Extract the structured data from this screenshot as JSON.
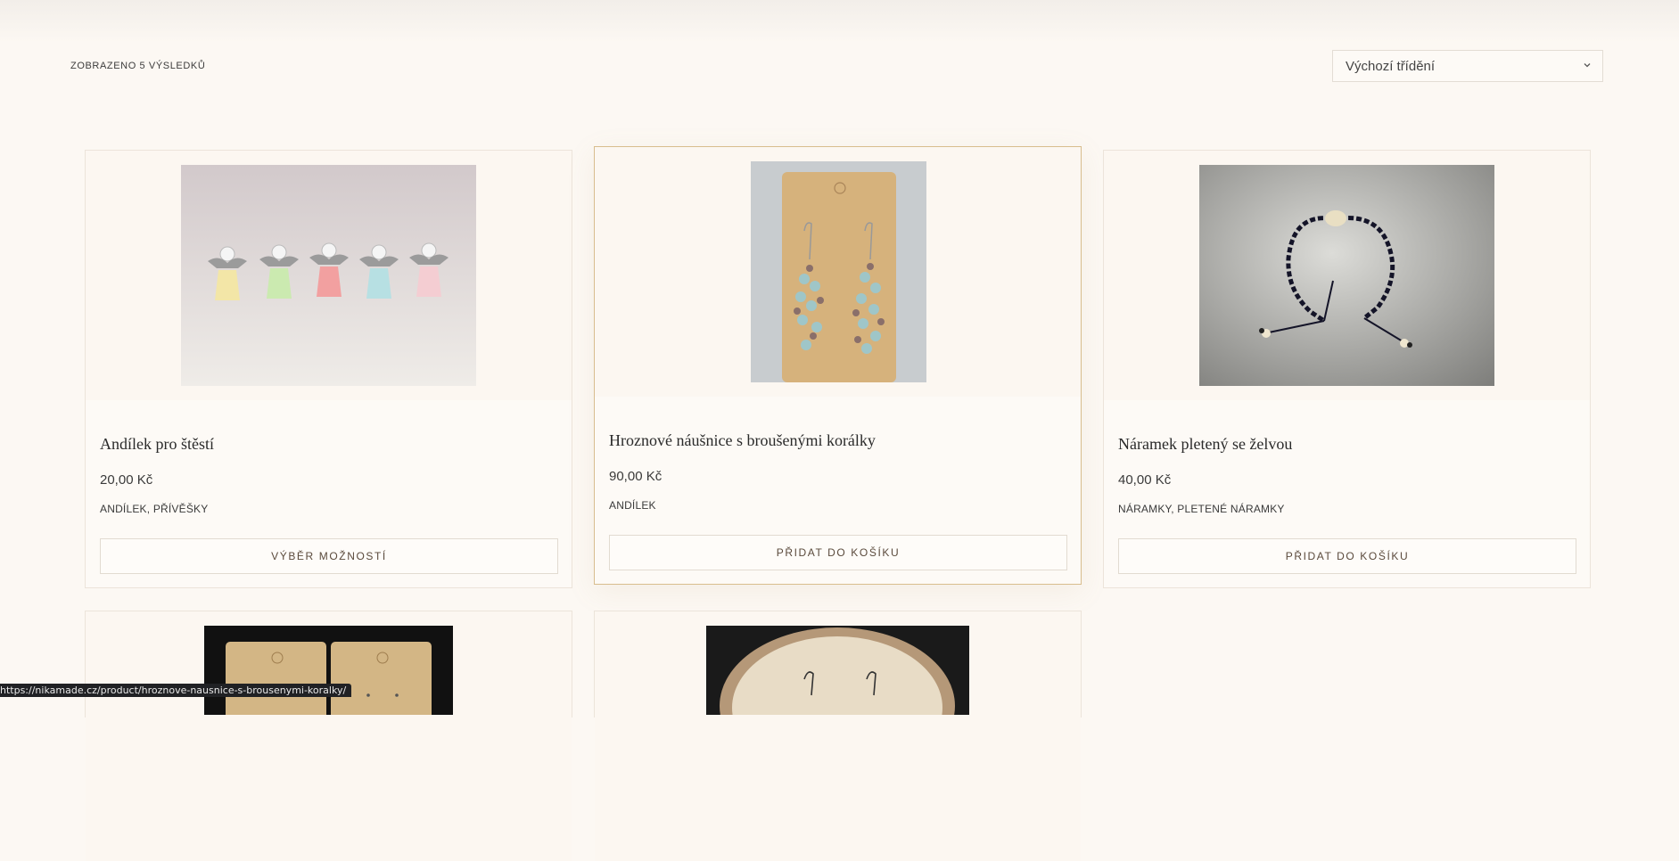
{
  "toolbar": {
    "result_count": "ZOBRAZENO 5 VÝSLEDKŮ",
    "sort_selected": "Výchozí třídění"
  },
  "products": [
    {
      "title": "Andílek pro štěstí",
      "price": "20,00 Kč",
      "categories": "ANDÍLEK, PŘÍVĚŠKY",
      "button": "VÝBĚR MOŽNOSTÍ",
      "image_icon": "angel-pendants-photo"
    },
    {
      "title": "Hroznové náušnice s broušenými korálky",
      "price": "90,00 Kč",
      "categories": "ANDÍLEK",
      "button": "PŘIDAT DO KOŠÍKU",
      "image_icon": "grape-earrings-photo"
    },
    {
      "title": "Náramek pletený se želvou",
      "price": "40,00 Kč",
      "categories": "NÁRAMKY, PLETENÉ NÁRAMKY",
      "button": "PŘIDAT DO KOŠÍKU",
      "image_icon": "turtle-bracelet-photo"
    },
    {
      "image_icon": "earring-cards-photo"
    },
    {
      "image_icon": "wood-slice-earrings-photo"
    }
  ],
  "status_bar": {
    "url": "https://nikamade.cz/product/hroznove-nausnice-s-brousenymi-koralky/"
  },
  "colors": {
    "background": "#fcf8f3",
    "card_border": "#ece4da",
    "hover_border": "#d8bd8e",
    "text": "#333333"
  }
}
